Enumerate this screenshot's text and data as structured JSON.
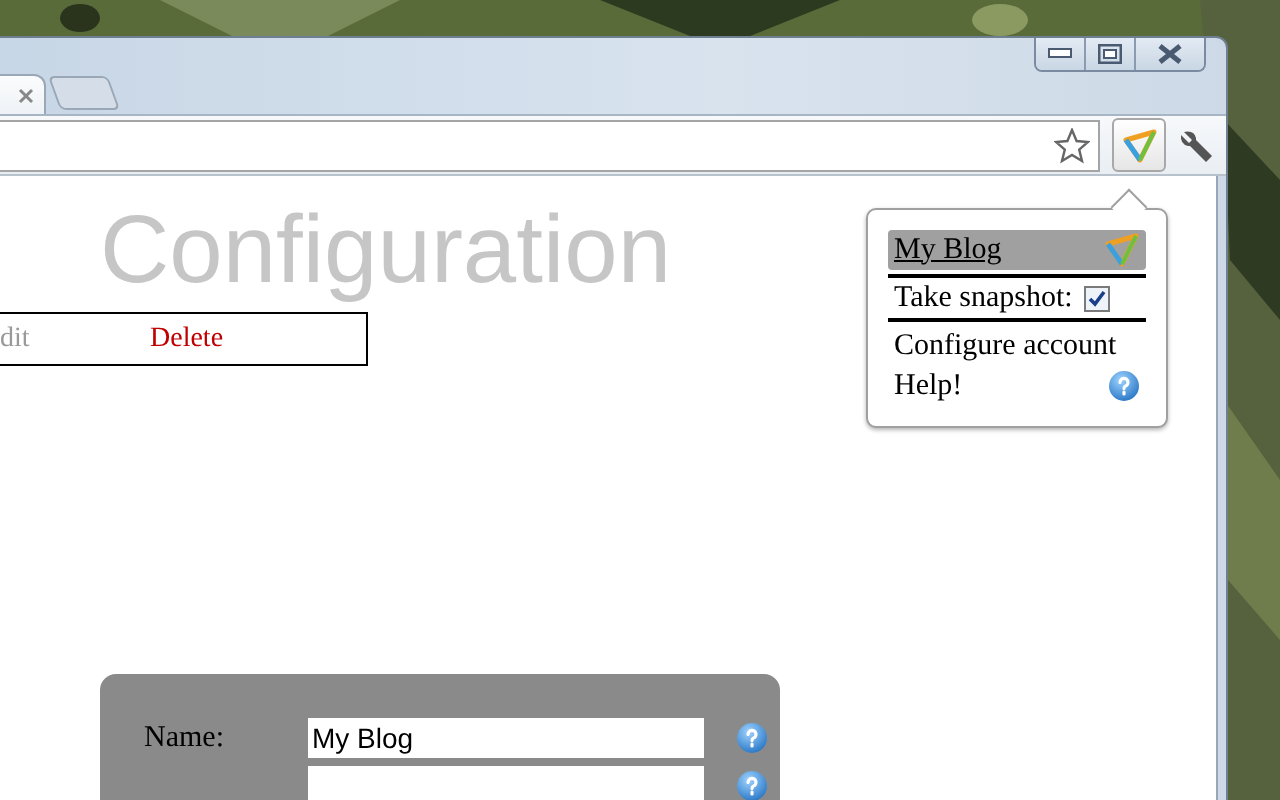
{
  "page": {
    "heading": "Configuration",
    "account_row": {
      "edit": "dit",
      "delete": "Delete"
    },
    "form": {
      "fields": [
        {
          "label": "Name:",
          "value": "My Blog"
        },
        {
          "kind": "partial"
        }
      ]
    }
  },
  "popup": {
    "items": [
      {
        "kind": "account",
        "label": "My Blog",
        "selected": true
      },
      {
        "kind": "checkbox",
        "label": "Take snapshot:",
        "checked": true
      },
      {
        "kind": "link",
        "label": "Configure account"
      },
      {
        "kind": "help",
        "label": "Help!"
      }
    ]
  }
}
